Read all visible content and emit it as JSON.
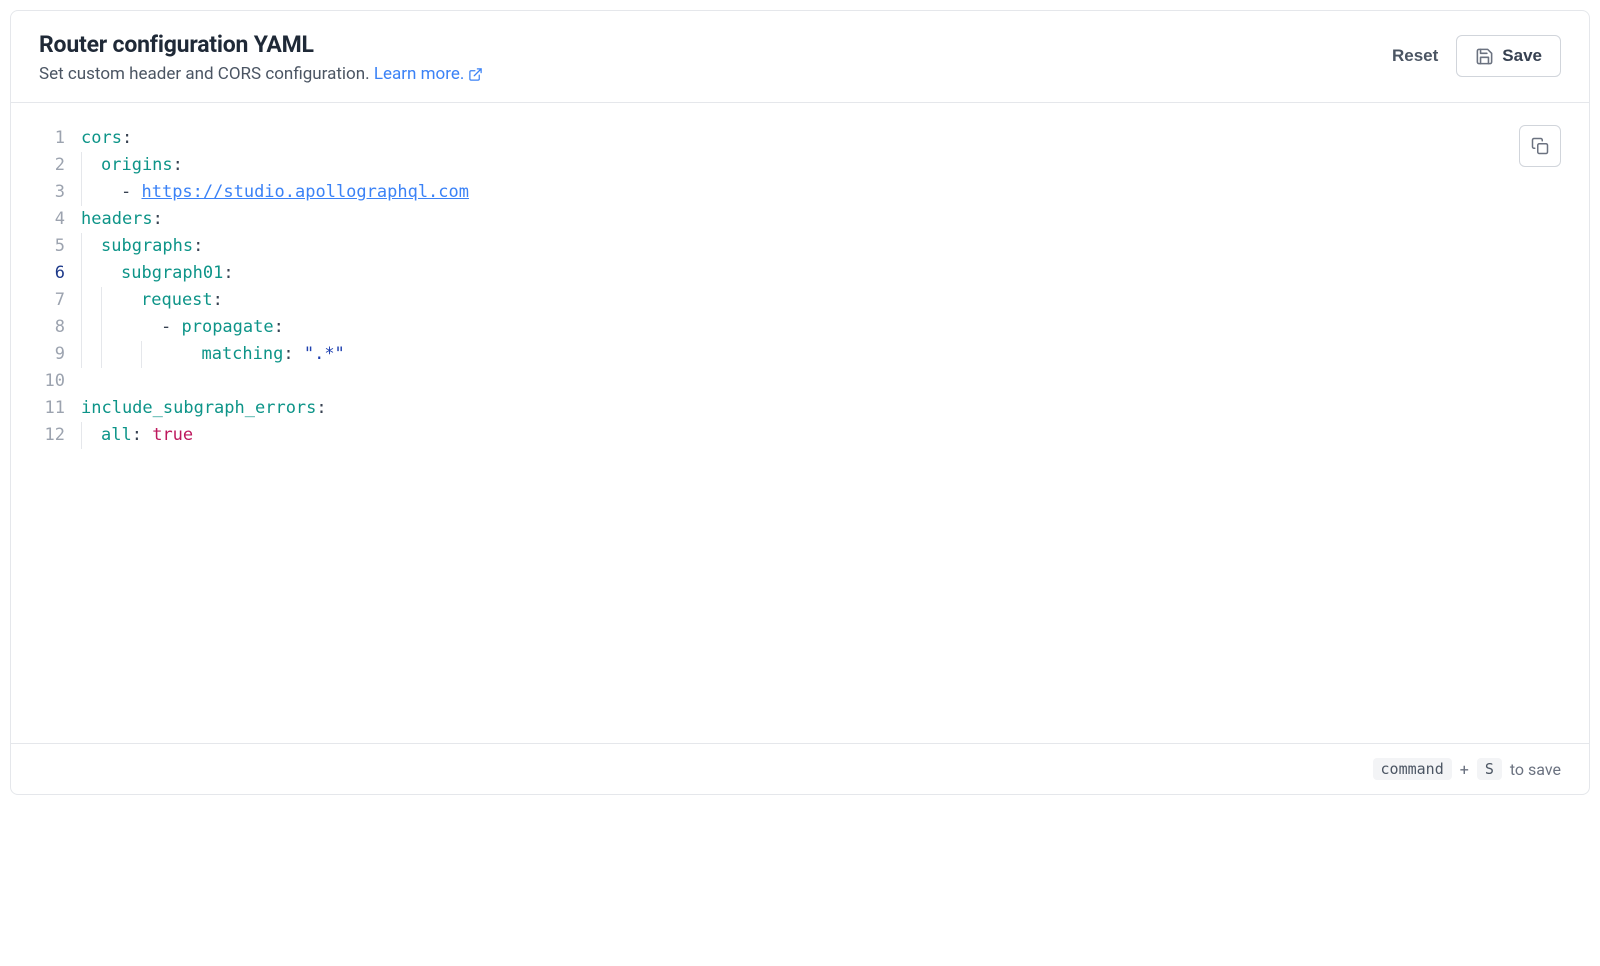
{
  "header": {
    "title": "Router configuration YAML",
    "subtitle": "Set custom header and CORS configuration.",
    "learn_more": "Learn more."
  },
  "actions": {
    "reset": "Reset",
    "save": "Save"
  },
  "footer": {
    "key1": "command",
    "plus": "+",
    "key2": "S",
    "suffix": "to save"
  },
  "editor": {
    "active_line": 6,
    "lines": [
      {
        "n": 1,
        "indent": 0,
        "guides": [],
        "tokens": [
          {
            "t": "cors",
            "c": "tok-key"
          },
          {
            "t": ":",
            "c": "tok-punc"
          }
        ]
      },
      {
        "n": 2,
        "indent": 1,
        "guides": [
          true
        ],
        "tokens": [
          {
            "t": "origins",
            "c": "tok-key"
          },
          {
            "t": ":",
            "c": "tok-punc"
          }
        ]
      },
      {
        "n": 3,
        "indent": 2,
        "guides": [
          true,
          false
        ],
        "tokens": [
          {
            "t": "- ",
            "c": "tok-dash"
          },
          {
            "t": "https://studio.apollographql.com",
            "c": "tok-url"
          }
        ]
      },
      {
        "n": 4,
        "indent": 0,
        "guides": [],
        "tokens": [
          {
            "t": "headers",
            "c": "tok-key"
          },
          {
            "t": ":",
            "c": "tok-punc"
          }
        ]
      },
      {
        "n": 5,
        "indent": 1,
        "guides": [
          true
        ],
        "tokens": [
          {
            "t": "subgraphs",
            "c": "tok-key"
          },
          {
            "t": ":",
            "c": "tok-punc"
          }
        ]
      },
      {
        "n": 6,
        "indent": 2,
        "guides": [
          true,
          false
        ],
        "tokens": [
          {
            "t": "subgraph01",
            "c": "tok-key"
          },
          {
            "t": ":",
            "c": "tok-punc"
          }
        ]
      },
      {
        "n": 7,
        "indent": 3,
        "guides": [
          true,
          true,
          false
        ],
        "tokens": [
          {
            "t": "request",
            "c": "tok-key"
          },
          {
            "t": ":",
            "c": "tok-punc"
          }
        ]
      },
      {
        "n": 8,
        "indent": 4,
        "guides": [
          true,
          true,
          false,
          false
        ],
        "tokens": [
          {
            "t": "- ",
            "c": "tok-dash"
          },
          {
            "t": "propagate",
            "c": "tok-key"
          },
          {
            "t": ":",
            "c": "tok-punc"
          }
        ]
      },
      {
        "n": 9,
        "indent": 5,
        "guides": [
          true,
          true,
          false,
          true,
          false
        ],
        "tokens": [
          {
            "t": "  matching",
            "c": "tok-key"
          },
          {
            "t": ": ",
            "c": "tok-punc"
          },
          {
            "t": "\".*\"",
            "c": "tok-str"
          }
        ]
      },
      {
        "n": 10,
        "indent": 0,
        "guides": [],
        "tokens": []
      },
      {
        "n": 11,
        "indent": 0,
        "guides": [],
        "tokens": [
          {
            "t": "include_subgraph_errors",
            "c": "tok-key"
          },
          {
            "t": ":",
            "c": "tok-punc"
          }
        ]
      },
      {
        "n": 12,
        "indent": 1,
        "guides": [
          true
        ],
        "tokens": [
          {
            "t": "all",
            "c": "tok-key"
          },
          {
            "t": ": ",
            "c": "tok-punc"
          },
          {
            "t": "true",
            "c": "tok-bool"
          }
        ]
      }
    ]
  }
}
